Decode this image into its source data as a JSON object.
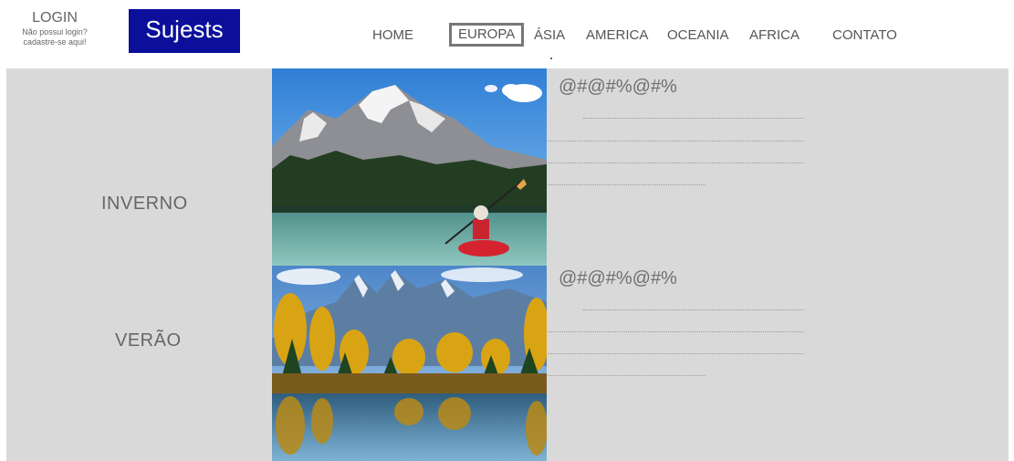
{
  "header": {
    "login_title": "LOGIN",
    "login_line1": "Não possui login?",
    "login_line2": "cadastre-se aqui!",
    "logo": "Sujests"
  },
  "nav": {
    "items": [
      {
        "label": "HOME"
      },
      {
        "label": "EUROPA"
      },
      {
        "label": "ÁSIA"
      },
      {
        "label": "AMERICA"
      },
      {
        "label": "OCEANIA"
      },
      {
        "label": "AFRICA"
      },
      {
        "label": "CONTATO"
      }
    ]
  },
  "sections": [
    {
      "season": "INVERNO",
      "heading": "@#@#%@#%"
    },
    {
      "season": "VERÃO",
      "heading": "@#@#%@#%"
    }
  ],
  "colors": {
    "logo_bg": "#0b0f9a",
    "panel_bg": "#d9d9d9"
  }
}
